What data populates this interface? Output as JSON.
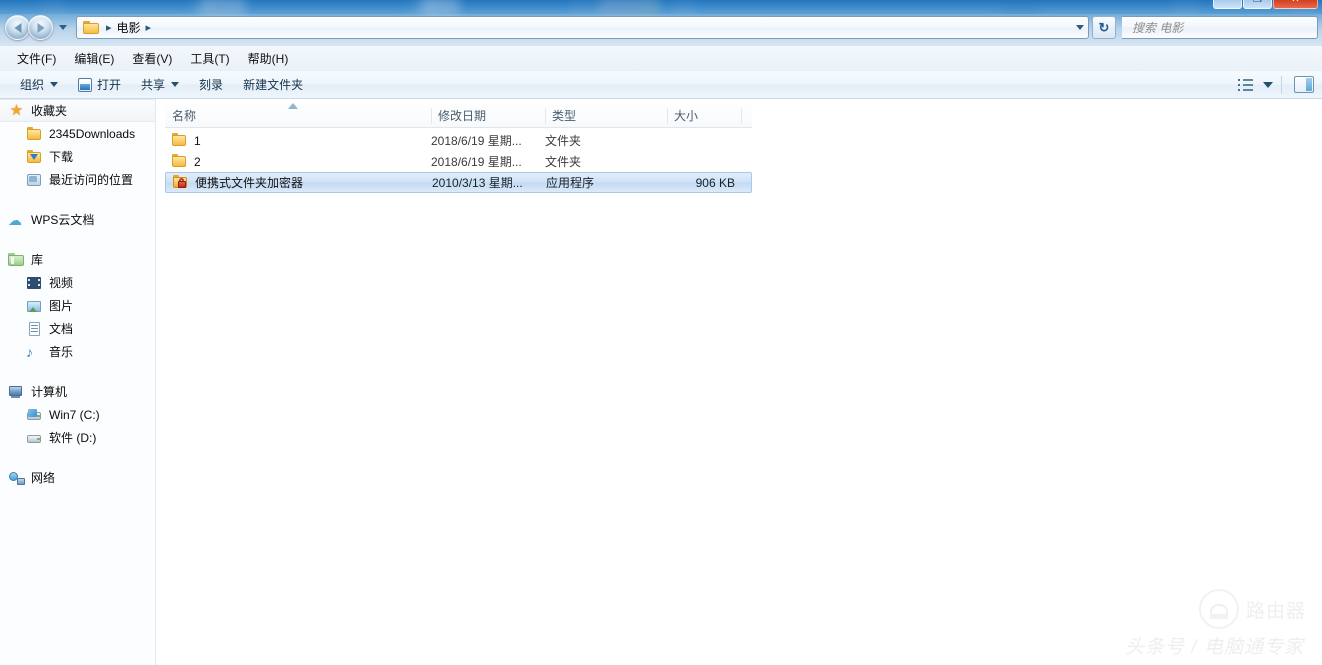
{
  "window": {
    "controls": [
      {
        "name": "minimize",
        "glyph": "—"
      },
      {
        "name": "maximize",
        "glyph": "❐"
      },
      {
        "name": "close",
        "glyph": "✕"
      }
    ]
  },
  "address_bar": {
    "back_tooltip": "后退",
    "forward_tooltip": "前进",
    "separator": "▸",
    "breadcrumb": [
      "电影"
    ],
    "refresh_glyph": "↻"
  },
  "search": {
    "placeholder": "搜索 电影"
  },
  "menubar": {
    "items": [
      {
        "label": "文件(F)"
      },
      {
        "label": "编辑(E)"
      },
      {
        "label": "查看(V)"
      },
      {
        "label": "工具(T)"
      },
      {
        "label": "帮助(H)"
      }
    ]
  },
  "toolbar": {
    "organize_label": "组织",
    "open_label": "打开",
    "share_label": "共享",
    "burn_label": "刻录",
    "new_folder_label": "新建文件夹"
  },
  "sidebar": {
    "groups": [
      {
        "header": {
          "label": "收藏夹",
          "icon": "star-icon",
          "hovered": true
        },
        "items": [
          {
            "label": "2345Downloads",
            "icon": "folder-icon"
          },
          {
            "label": "下载",
            "icon": "downloads-icon"
          },
          {
            "label": "最近访问的位置",
            "icon": "recent-places-icon"
          }
        ]
      },
      {
        "header": {
          "label": "WPS云文档",
          "icon": "cloud-icon",
          "hovered": false
        },
        "items": []
      },
      {
        "header": {
          "label": "库",
          "icon": "library-icon",
          "hovered": false
        },
        "items": [
          {
            "label": "视频",
            "icon": "video-icon"
          },
          {
            "label": "图片",
            "icon": "pictures-icon"
          },
          {
            "label": "文档",
            "icon": "documents-icon"
          },
          {
            "label": "音乐",
            "icon": "music-icon"
          }
        ]
      },
      {
        "header": {
          "label": "计算机",
          "icon": "computer-icon",
          "hovered": false
        },
        "items": [
          {
            "label": "Win7 (C:)",
            "icon": "system-drive-icon"
          },
          {
            "label": "软件 (D:)",
            "icon": "drive-icon"
          }
        ]
      },
      {
        "header": {
          "label": "网络",
          "icon": "network-icon",
          "hovered": false
        },
        "items": []
      }
    ]
  },
  "file_list": {
    "columns": [
      {
        "label": "名称",
        "sorted": true,
        "sort_direction": "asc"
      },
      {
        "label": "修改日期",
        "sorted": false
      },
      {
        "label": "类型",
        "sorted": false
      },
      {
        "label": "大小",
        "sorted": false
      }
    ],
    "rows": [
      {
        "name": "1",
        "date": "2018/6/19 星期...",
        "type": "文件夹",
        "size": "",
        "icon": "folder-icon",
        "selected": false
      },
      {
        "name": "2",
        "date": "2018/6/19 星期...",
        "type": "文件夹",
        "size": "",
        "icon": "folder-icon",
        "selected": false
      },
      {
        "name": "便携式文件夹加密器",
        "date": "2010/3/13 星期...",
        "type": "应用程序",
        "size": "906 KB",
        "icon": "locked-folder-app-icon",
        "selected": true
      }
    ]
  },
  "watermarks": {
    "router": "路由器",
    "toutiao": "头条号 / 电脑通专家"
  },
  "colors": {
    "selection": "#cfe2f6",
    "selection_border": "#a8c9e8",
    "aero_blue": "#2d86d8",
    "folder_yellow": "#f5bb3d",
    "lock_red": "#c32b19"
  }
}
